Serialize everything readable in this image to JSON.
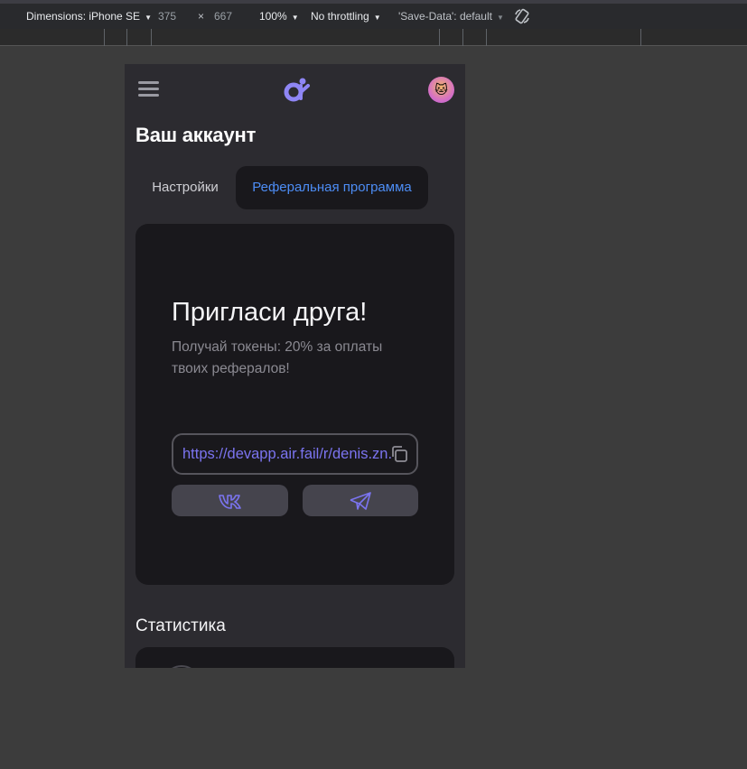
{
  "devtools": {
    "dimensions_label": "Dimensions: iPhone SE",
    "width": "375",
    "times": "×",
    "height": "667",
    "zoom": "100%",
    "throttling": "No throttling",
    "save_data": "'Save-Data': default",
    "icons": {
      "dropdown": "caret-down-icon",
      "rotate": "rotate-icon"
    }
  },
  "app": {
    "header": {
      "menu_icon": "hamburger-icon",
      "logo_icon": "app-logo-icon",
      "avatar_emoji": "🐱"
    },
    "page_title": "Ваш аккаунт",
    "tabs": [
      {
        "label": "Настройки",
        "active": false
      },
      {
        "label": "Реферальная программа",
        "active": true
      }
    ],
    "invite": {
      "title": "Пригласи друга!",
      "description": "Получай токены: 20% за оплаты твоих рефералов!",
      "link": "https://devapp.air.fail/r/denis.zn.l",
      "copy_icon": "copy-icon",
      "share_buttons": [
        {
          "icon": "vk-icon"
        },
        {
          "icon": "telegram-icon"
        }
      ]
    },
    "stats_title": "Статистика",
    "colors": {
      "background": "#2c2b30",
      "card": "#19181c",
      "accent_blue": "#4d8df5",
      "accent_purple": "#7b74f0",
      "button": "#45444d"
    }
  }
}
